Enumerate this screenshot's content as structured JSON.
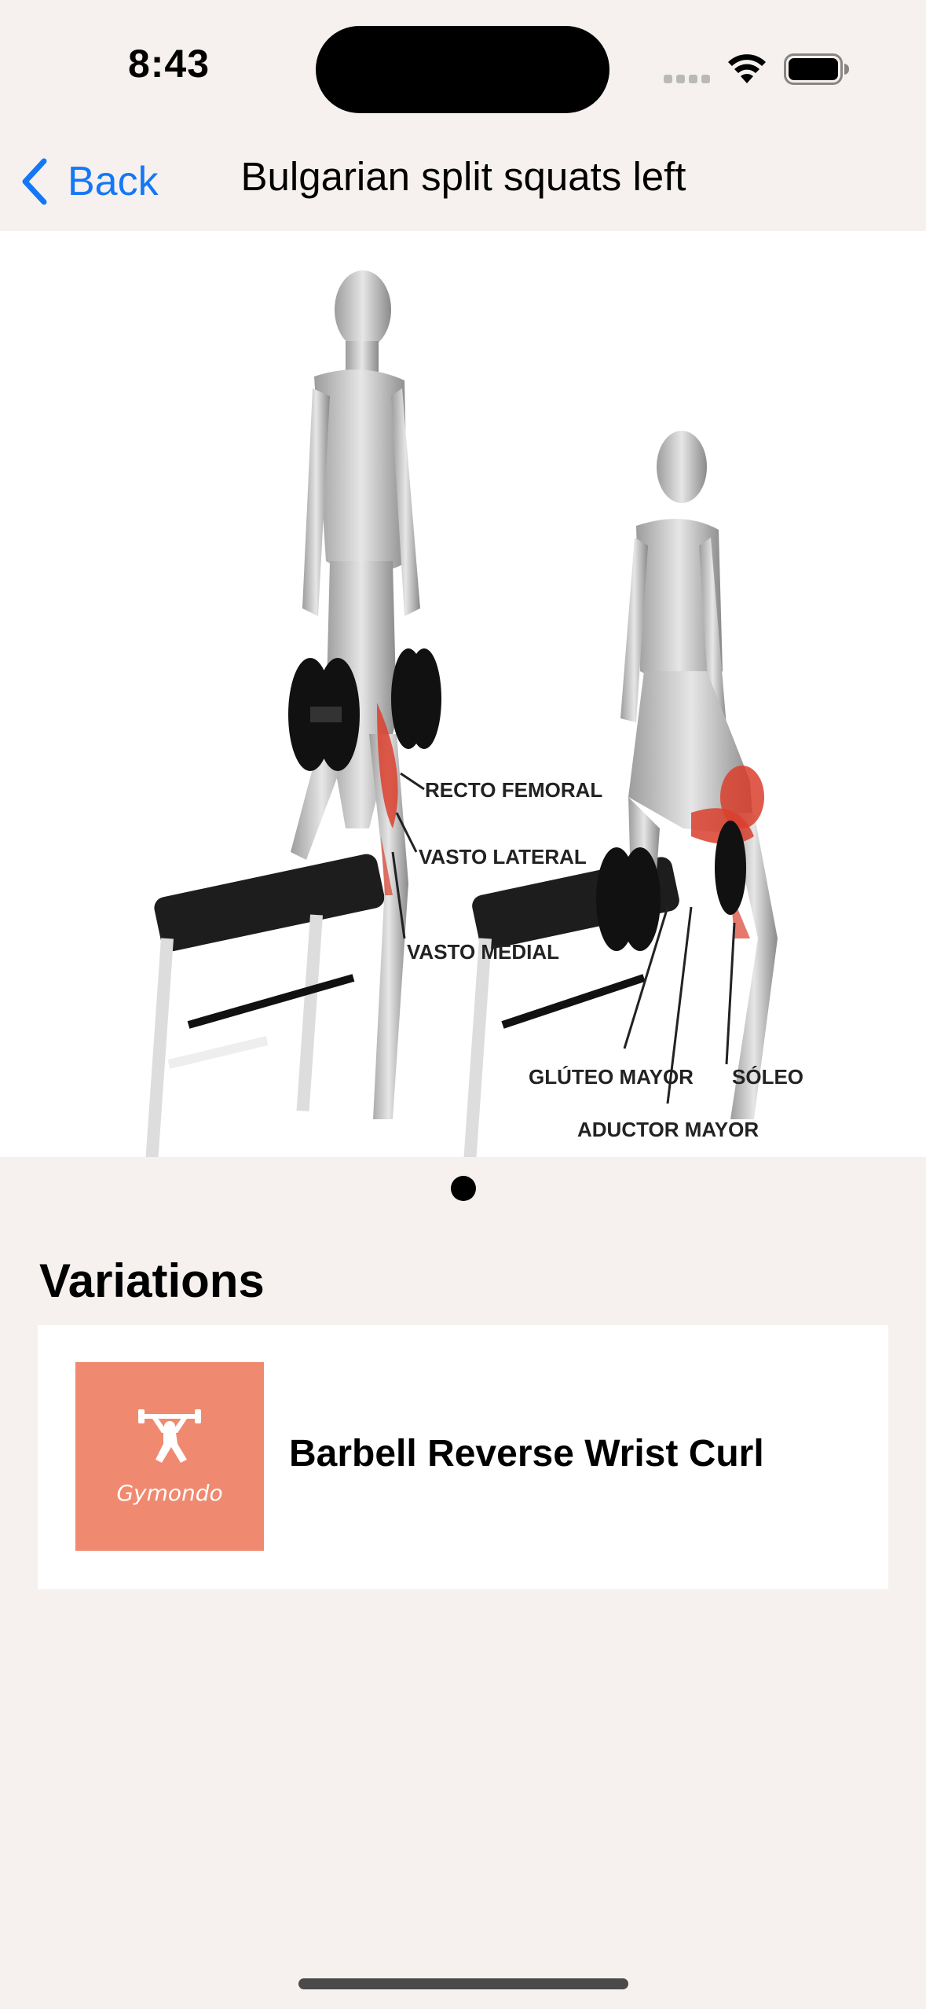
{
  "status_bar": {
    "time": "8:43",
    "icons": [
      "cellular-signal-icon",
      "wifi-icon",
      "battery-icon"
    ]
  },
  "nav": {
    "back_label": "Back",
    "title": "Bulgarian split squats left",
    "accent_color": "#1478f6"
  },
  "image": {
    "labels": [
      "RECTO FEMORAL",
      "VASTO LATERAL",
      "VASTO MEDIAL",
      "GLÚTEO MAYOR",
      "ADUCTOR MAYOR",
      "SÓLEO"
    ],
    "page_count": 1,
    "current_page": 1
  },
  "variations": {
    "title": "Variations",
    "items": [
      {
        "name": "Barbell Reverse Wrist Curl",
        "thumb_brand": "Gymondo",
        "thumb_color": "#ef8a70"
      }
    ]
  }
}
